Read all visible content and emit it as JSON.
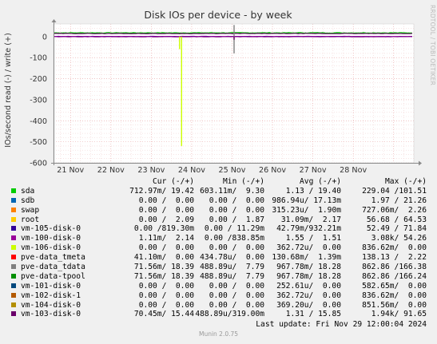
{
  "chart_data": {
    "type": "line",
    "title": "Disk IOs per device - by week",
    "ylabel": "IOs/second read (-) / write (+)",
    "ylim": [
      -600,
      60
    ],
    "yticks": [
      0,
      -100,
      -200,
      -300,
      -400,
      -500,
      -600
    ],
    "xticks": [
      "21 Nov",
      "22 Nov",
      "23 Nov",
      "24 Nov",
      "25 Nov",
      "26 Nov",
      "27 Nov",
      "28 Nov"
    ],
    "x_range_days": [
      20.58,
      29.5
    ],
    "grid": true,
    "spikes": [
      {
        "series": "vm-106-disk-0",
        "day": 23.75,
        "value": -520
      },
      {
        "series": "vm-106-disk-0",
        "day": 23.7,
        "value": -60
      },
      {
        "series": "pve-data_tdata",
        "day": 25.05,
        "value": 55
      },
      {
        "series": "pve-data_tdata",
        "day": 25.05,
        "value": -80
      },
      {
        "series": "vm-103-disk-0",
        "day": 25.05,
        "value": -15
      }
    ],
    "series": [
      {
        "name": "sda",
        "color": "#00cc00",
        "cur": "712.97m/ 19.42",
        "min": "603.11m/  9.30",
        "avg": "1.13 / 19.40",
        "max": "229.04 /101.51"
      },
      {
        "name": "sdb",
        "color": "#0066b3",
        "cur": "0.00 /  0.00",
        "min": "0.00 /  0.00",
        "avg": "986.94u/ 17.13m",
        "max": "1.97 / 21.26"
      },
      {
        "name": "swap",
        "color": "#ff8000",
        "cur": "0.00 /  0.00",
        "min": "0.00 /  0.00",
        "avg": "315.23u/  1.90m",
        "max": "727.06m/  2.26"
      },
      {
        "name": "root",
        "color": "#ffcc00",
        "cur": "0.00 /  2.09",
        "min": "0.00 /  1.87",
        "avg": "31.09m/  2.17",
        "max": "56.68 / 64.53"
      },
      {
        "name": "vm-105-disk-0",
        "color": "#330099",
        "cur": "0.00 /819.30m",
        "min": "0.00 / 11.29m",
        "avg": "42.79m/932.21m",
        "max": "52.49 / 71.84"
      },
      {
        "name": "vm-100-disk-0",
        "color": "#990099",
        "cur": "1.11m/  2.14",
        "min": "0.00 /838.85m",
        "avg": "1.55 /  1.51",
        "max": "3.08k/ 54.26"
      },
      {
        "name": "vm-106-disk-0",
        "color": "#ccff00",
        "cur": "0.00 /  0.00",
        "min": "0.00 /  0.00",
        "avg": "362.72u/  0.00",
        "max": "836.62m/  0.00"
      },
      {
        "name": "pve-data_tmeta",
        "color": "#ff0000",
        "cur": "41.10m/  0.00",
        "min": "434.78u/  0.00",
        "avg": "130.68m/  1.39m",
        "max": "138.13 /  2.22"
      },
      {
        "name": "pve-data_tdata",
        "color": "#808080",
        "cur": "71.56m/ 18.39",
        "min": "488.89u/  7.79",
        "avg": "967.78m/ 18.28",
        "max": "862.86 /166.38"
      },
      {
        "name": "pve-data-tpool",
        "color": "#008f00",
        "cur": "71.56m/ 18.39",
        "min": "488.89u/  7.79",
        "avg": "967.78m/ 18.28",
        "max": "862.86 /166.24"
      },
      {
        "name": "vm-101-disk-0",
        "color": "#00487d",
        "cur": "0.00 /  0.00",
        "min": "0.00 /  0.00",
        "avg": "252.61u/  0.00",
        "max": "582.65m/  0.00"
      },
      {
        "name": "vm-102-disk-1",
        "color": "#b35a00",
        "cur": "0.00 /  0.00",
        "min": "0.00 /  0.00",
        "avg": "362.72u/  0.00",
        "max": "836.62m/  0.00"
      },
      {
        "name": "vm-104-disk-0",
        "color": "#b38f00",
        "cur": "0.00 /  0.00",
        "min": "0.00 /  0.00",
        "avg": "369.20u/  0.00",
        "max": "851.56m/  0.00"
      },
      {
        "name": "vm-103-disk-0",
        "color": "#6b006b",
        "cur": "70.45m/ 15.44",
        "min": "488.89u/319.00m",
        "avg": "1.31 / 15.85",
        "max": "1.94k/ 91.65"
      }
    ]
  },
  "legend_headers": {
    "cur": "Cur (-/+)",
    "min": "Min (-/+)",
    "avg": "Avg (-/+)",
    "max": "Max (-/+)"
  },
  "last_update": "Last update: Fri Nov 29 12:00:04 2024",
  "footer": "Munin 2.0.75",
  "side_label": "RRDTOOL / TOBI OETIKER"
}
